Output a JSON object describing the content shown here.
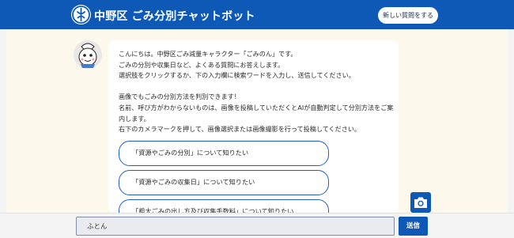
{
  "header": {
    "logo_icon": "nakano-ward-emblem-icon",
    "title": "中野区 ごみ分別チャットボット",
    "new_question_label": "新しい質問をする",
    "color": "#0d59b5"
  },
  "chat": {
    "avatar_icon": "gomi-non-mascot-avatar",
    "message_lines": [
      "こんにちは。中野区ごみ減量キャラクター「ごみのん」です。",
      "ごみの分別や収集日など、よくある質問にお答えします。",
      "選択肢をクリックするか、下の入力欄に検索ワードを入力し、送信してください。",
      "",
      "画像でもごみの分別方法を判別できます！",
      "名前、呼び方がわからないものは、画像を投稿していただくとAIが自動判定して分別方法をご案",
      "内します。",
      "右下のカメラマークを押して、画像選択または画像撮影を行って投稿してください。"
    ],
    "options": [
      "「資源やごみの分別」について知りたい",
      "「資源やごみの収集日」について知りたい",
      "「粗大ごみの出し方及び収集手数料」について知りたい"
    ]
  },
  "input": {
    "value": "ふとん",
    "camera_icon": "camera-icon"
  },
  "footer": {
    "send_label": "送信"
  }
}
